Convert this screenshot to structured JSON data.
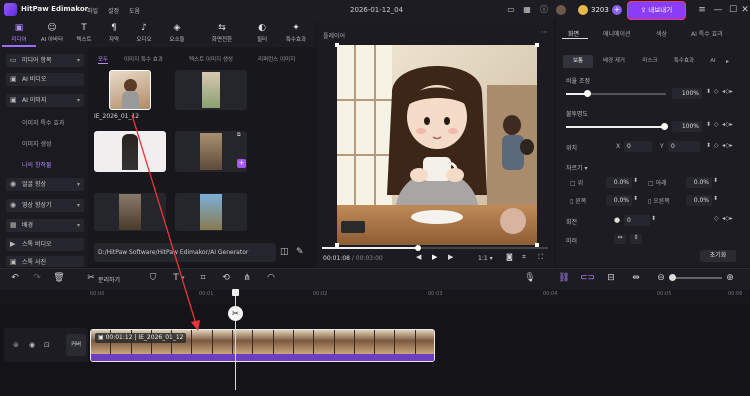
{
  "app": {
    "name": "HitPaw Edimakor",
    "menus": [
      "파일",
      "설정",
      "도움"
    ],
    "document_title": "2026-01-12_04",
    "credits": "3203",
    "export_label": "내보내기"
  },
  "top_tabs": [
    {
      "icon": "media-icon",
      "label": "미디어",
      "active": true
    },
    {
      "icon": "ai-icon",
      "label": "AI 아바타"
    },
    {
      "icon": "text-icon",
      "label": "텍스트"
    },
    {
      "icon": "subtitle-icon",
      "label": "자막"
    },
    {
      "icon": "audio-icon",
      "label": "오디오"
    },
    {
      "icon": "elements-icon",
      "label": "요소들"
    },
    {
      "icon": "transition-icon",
      "label": "화면전환"
    },
    {
      "icon": "filter-icon",
      "label": "필터"
    },
    {
      "icon": "effect-icon",
      "label": "특수효과"
    }
  ],
  "sidebar": {
    "items": [
      {
        "label": "미디어 항목",
        "icon": "folder-icon"
      },
      {
        "label": "AI 비디오",
        "icon": "ai-video-icon"
      },
      {
        "label": "AI 이미지",
        "icon": "ai-image-icon",
        "expanded": true
      }
    ],
    "sub_items": [
      {
        "label": "이미지 특수 효과"
      },
      {
        "label": "이미지 생성"
      },
      {
        "label": "나의 창작물",
        "active": true
      }
    ],
    "more_items": [
      {
        "label": "얼굴 향상",
        "icon": "face-icon"
      },
      {
        "label": "영상 향상기",
        "icon": "enhance-icon"
      },
      {
        "label": "배경",
        "icon": "background-icon"
      },
      {
        "label": "스톡 비디오",
        "icon": "stock-video-icon"
      },
      {
        "label": "스톡 사진",
        "icon": "stock-photo-icon"
      }
    ]
  },
  "media": {
    "sub_tabs": [
      "모두",
      "이미지 특수 효과",
      "텍스트 이미지 생성",
      "리퍼런스 이미지"
    ],
    "selected_label": "IE_2026_01_12",
    "path": "D:/HitPaw Software/HitPaw Edimakor/AI Generator"
  },
  "player": {
    "title": "플레이어",
    "current_time": "00:01:08",
    "total_time": "/ 00:03:00",
    "ratio": "1:1"
  },
  "props": {
    "tabs": [
      "화면",
      "애니메이션",
      "색상",
      "AI 특수 효과"
    ],
    "sub_tabs": [
      "보통",
      "배경 제거",
      "마스크",
      "특수효과",
      "AI"
    ],
    "scale_label": "비율 조정",
    "scale_value": "100%",
    "opacity_label": "불투명도",
    "opacity_value": "100%",
    "position_label": "위치",
    "x_label": "X",
    "x_value": "0",
    "y_label": "Y",
    "y_value": "0",
    "crop_label": "자르기",
    "crop_top_label": "위",
    "crop_top": "0.0%",
    "crop_bottom_label": "아래",
    "crop_bottom": "0.0%",
    "crop_left_label": "왼쪽",
    "crop_left": "0.0%",
    "crop_right_label": "오른쪽",
    "crop_right": "0.0%",
    "rotate_label": "회전",
    "rotate_value": "0",
    "mirror_label": "미러",
    "reset_label": "초기화"
  },
  "timeline": {
    "split_label": "분리하기",
    "ruler": [
      "00:00",
      "00:01",
      "00:02",
      "00:03",
      "00:04",
      "00:05",
      "00:06"
    ],
    "cover_label": "커버",
    "clip_time": "00:01:12",
    "clip_name": "IE_2026_01_12"
  },
  "colors": {
    "accent": "#8b3df5",
    "highlight": "#ff3a6a",
    "arrow": "#e8343a"
  }
}
